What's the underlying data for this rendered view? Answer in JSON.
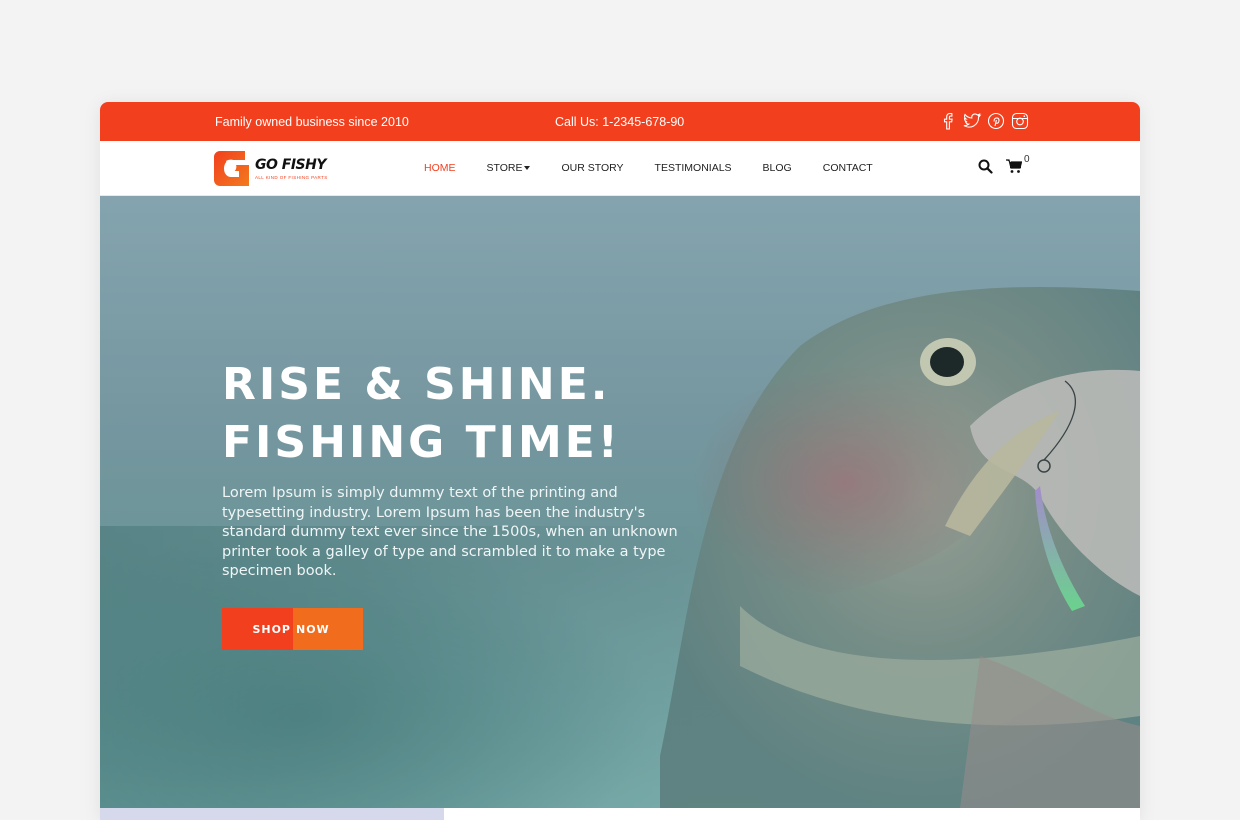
{
  "topbar": {
    "tagline": "Family owned business since 2010",
    "phone": "Call Us: 1-2345-678-90",
    "socials": [
      "facebook-icon",
      "twitter-icon",
      "pinterest-icon",
      "instagram-icon"
    ]
  },
  "brand": {
    "name": "GO FISHY",
    "tagline": "ALL KIND OF FISHING PARTS",
    "accent": "#f23f1e",
    "accent_secondary": "#f26c1e"
  },
  "nav": {
    "items": [
      {
        "label": "HOME",
        "active": true
      },
      {
        "label": "STORE",
        "dropdown": true
      },
      {
        "label": "OUR STORY"
      },
      {
        "label": "TESTIMONIALS"
      },
      {
        "label": "BLOG"
      },
      {
        "label": "CONTACT"
      }
    ],
    "cart_count": "0"
  },
  "hero": {
    "title_line1": "RISE & SHINE.",
    "title_line2": "FISHING TIME!",
    "text": "Lorem Ipsum is simply dummy text of the printing and typesetting industry. Lorem Ipsum has been the industry's standard dummy text ever since the 1500s, when an unknown printer took a galley of type and scrambled it to make a type specimen book.",
    "cta_left": "SHOP",
    "cta_right": "NOW"
  }
}
